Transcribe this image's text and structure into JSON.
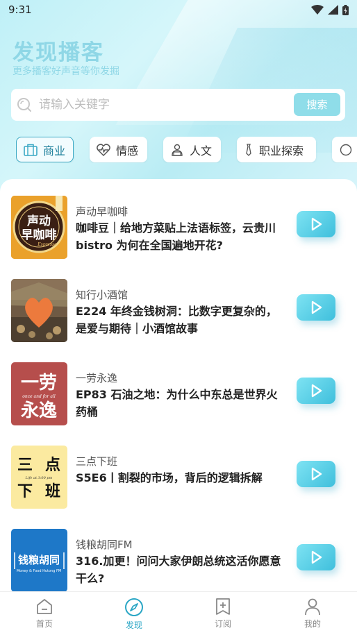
{
  "status_bar": {
    "time": "9:31"
  },
  "header": {
    "title": "发现播客",
    "subtitle": "更多播客好声音等你发掘"
  },
  "search": {
    "placeholder": "请输入关键字",
    "button_label": "搜索"
  },
  "categories": [
    {
      "label": "商业",
      "icon": "briefcase-icon",
      "active": true
    },
    {
      "label": "情感",
      "icon": "heartbeat-icon",
      "active": false
    },
    {
      "label": "人文",
      "icon": "reader-icon",
      "active": false
    },
    {
      "label": "职业探索",
      "icon": "tie-icon",
      "active": false
    }
  ],
  "episodes": [
    {
      "show": "声动早咖啡",
      "title": "咖啡豆｜给地方菜贴上法语标签，云贵川 bistro 为何在全国遍地开花?",
      "cover_text": [
        "声动",
        "早咖啡"
      ],
      "cover_sub": "Espresso"
    },
    {
      "show": "知行小酒馆",
      "title": "E224 年终金钱树洞：比数字更复杂的，是爱与期待｜小酒馆故事"
    },
    {
      "show": "一劳永逸",
      "title": "EP83 石油之地：为什么中东总是世界火药桶",
      "cover_text": [
        "一劳",
        "永逸"
      ],
      "cover_sub": "once and for all"
    },
    {
      "show": "三点下班",
      "title": "S5E6丨割裂的市场，背后的逻辑拆解",
      "cover_text": [
        "三",
        "点",
        "下",
        "班"
      ],
      "cover_sub": "Life at 3:00 pm"
    },
    {
      "show": "钱粮胡同FM",
      "title": "316.加更！问问大家伊朗总统这活你愿意干么?",
      "cover_text": [
        "钱粮胡同"
      ],
      "cover_sub": "Money & Food Hutong FM"
    }
  ],
  "tabs": [
    {
      "label": "首页",
      "icon": "home-icon",
      "active": false
    },
    {
      "label": "发现",
      "icon": "compass-icon",
      "active": true
    },
    {
      "label": "订阅",
      "icon": "bookmark-add-icon",
      "active": false
    },
    {
      "label": "我的",
      "icon": "profile-icon",
      "active": false
    }
  ],
  "colors": {
    "accent": "#2aa6c5",
    "title": "#8fd7e6",
    "play_button": "#46c3de"
  }
}
